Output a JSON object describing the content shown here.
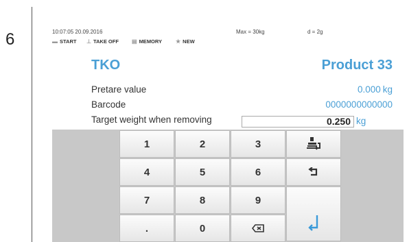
{
  "step_number": "6",
  "status": {
    "datetime": "10:07:05 20.09.2016",
    "max": "Max = 30kg",
    "d": "d = 2g"
  },
  "menu": [
    {
      "label": "START",
      "icon": "scale-icon"
    },
    {
      "label": "TAKE OFF",
      "icon": "take-off-icon"
    },
    {
      "label": "MEMORY",
      "icon": "memory-icon"
    },
    {
      "label": "NEW",
      "icon": "star-icon"
    }
  ],
  "mode_label": "TKO",
  "product_label": "Product 33",
  "rows": {
    "pretare_label": "Pretare value",
    "pretare_value": "0.000",
    "pretare_unit": "kg",
    "barcode_label": "Barcode",
    "barcode_value": "0000000000000",
    "target_label": "Target weight when removing",
    "target_value": "0.250",
    "target_unit": "kg"
  },
  "keypad": {
    "keys": [
      "1",
      "2",
      "3",
      "4",
      "5",
      "6",
      "7",
      "8",
      "9",
      ".",
      "0"
    ],
    "icons": [
      "weigh-in-icon",
      "backspace-icon",
      "delete-icon",
      "enter-icon"
    ]
  },
  "colors": {
    "accent": "#4a9fd5",
    "keypad_background": "#c8c8c8"
  }
}
